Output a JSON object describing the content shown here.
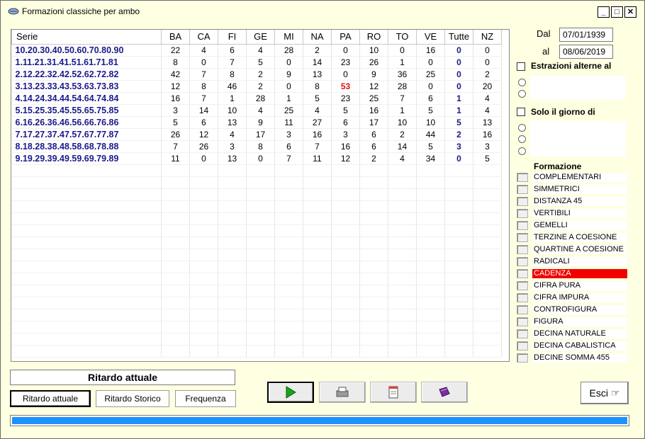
{
  "window": {
    "title": "Formazioni classiche per ambo"
  },
  "grid": {
    "columns": [
      "Serie",
      "BA",
      "CA",
      "FI",
      "GE",
      "MI",
      "NA",
      "PA",
      "RO",
      "TO",
      "VE",
      "Tutte",
      "NZ"
    ],
    "rows": [
      [
        "10.20.30.40.50.60.70.80.90",
        "22",
        "4",
        "6",
        "4",
        "28",
        "2",
        "0",
        "10",
        "0",
        "16",
        "0",
        "0"
      ],
      [
        "1.11.21.31.41.51.61.71.81",
        "8",
        "0",
        "7",
        "5",
        "0",
        "14",
        "23",
        "26",
        "1",
        "0",
        "0",
        "0"
      ],
      [
        "2.12.22.32.42.52.62.72.82",
        "42",
        "7",
        "8",
        "2",
        "9",
        "13",
        "0",
        "9",
        "36",
        "25",
        "0",
        "2"
      ],
      [
        "3.13.23.33.43.53.63.73.83",
        "12",
        "8",
        "46",
        "2",
        "0",
        "8",
        "53",
        "12",
        "28",
        "0",
        "0",
        "20"
      ],
      [
        "4.14.24.34.44.54.64.74.84",
        "16",
        "7",
        "1",
        "28",
        "1",
        "5",
        "23",
        "25",
        "7",
        "6",
        "1",
        "4"
      ],
      [
        "5.15.25.35.45.55.65.75.85",
        "3",
        "14",
        "10",
        "4",
        "25",
        "4",
        "5",
        "16",
        "1",
        "5",
        "1",
        "4"
      ],
      [
        "6.16.26.36.46.56.66.76.86",
        "5",
        "6",
        "13",
        "9",
        "11",
        "27",
        "6",
        "17",
        "10",
        "10",
        "5",
        "13"
      ],
      [
        "7.17.27.37.47.57.67.77.87",
        "26",
        "12",
        "4",
        "17",
        "3",
        "16",
        "3",
        "6",
        "2",
        "44",
        "2",
        "16"
      ],
      [
        "8.18.28.38.48.58.68.78.88",
        "7",
        "26",
        "3",
        "8",
        "6",
        "7",
        "16",
        "6",
        "14",
        "5",
        "3",
        "3"
      ],
      [
        "9.19.29.39.49.59.69.79.89",
        "11",
        "0",
        "13",
        "0",
        "7",
        "11",
        "12",
        "2",
        "4",
        "34",
        "0",
        "5"
      ]
    ],
    "highlight": {
      "row": 3,
      "col": 7,
      "color": "#e01010"
    },
    "empty_rows": 16
  },
  "dates": {
    "dal_label": "Dal",
    "dal_value": "07/01/1939",
    "al_label": "al",
    "al_value": "08/06/2019"
  },
  "options": {
    "estrazioni_label": "Estrazioni alterne al",
    "solo_label": "Solo il giorno di"
  },
  "formazione": {
    "heading": "Formazione",
    "items": [
      "COMPLEMENTARI",
      "SIMMETRICI",
      "DISTANZA 45",
      "VERTIBILI",
      "GEMELLI",
      "TERZINE A COESIONE",
      "QUARTINE A COESIONE",
      "RADICALI",
      "CADENZA",
      "CIFRA PURA",
      "CIFRA IMPURA",
      "CONTROFIGURA",
      "FIGURA",
      "DECINA NATURALE",
      "DECINA CABALISTICA",
      "DECINE SOMMA 455"
    ],
    "selected": "CADENZA",
    "selected_color": "#f00000"
  },
  "status": {
    "text": "Ritardo attuale"
  },
  "mode_buttons": {
    "attuale": "Ritardo attuale",
    "storico": "Ritardo Storico",
    "frequenza": "Frequenza"
  },
  "esci": {
    "label": "Esci"
  },
  "progress": {
    "value": 1.0,
    "color": "#1e90ff"
  },
  "icons": [
    "play-icon",
    "print-icon",
    "notes-icon",
    "book-icon",
    "pointing-hand-icon"
  ]
}
